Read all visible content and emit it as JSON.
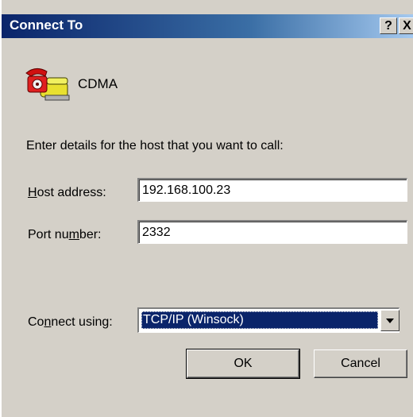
{
  "window": {
    "title": "Connect To",
    "help_button": "?",
    "close_button": "X"
  },
  "connection": {
    "icon": "phone-icon",
    "name": "CDMA"
  },
  "prompt": "Enter details for the host that you want to call:",
  "host_address": {
    "label_pre": "",
    "label_accel": "H",
    "label_post": "ost address:",
    "value": "192.168.100.23"
  },
  "port_number": {
    "label_pre": "Port nu",
    "label_accel": "m",
    "label_post": "ber:",
    "value": "2332"
  },
  "connect_using": {
    "label_pre": "Co",
    "label_accel": "n",
    "label_post": "nect using:",
    "selected": "TCP/IP (Winsock)"
  },
  "buttons": {
    "ok": "OK",
    "cancel": "Cancel"
  },
  "colors": {
    "titlebar_active": "#0a246a",
    "dialog_bg": "#d4d0c8",
    "selection": "#0a246a"
  }
}
